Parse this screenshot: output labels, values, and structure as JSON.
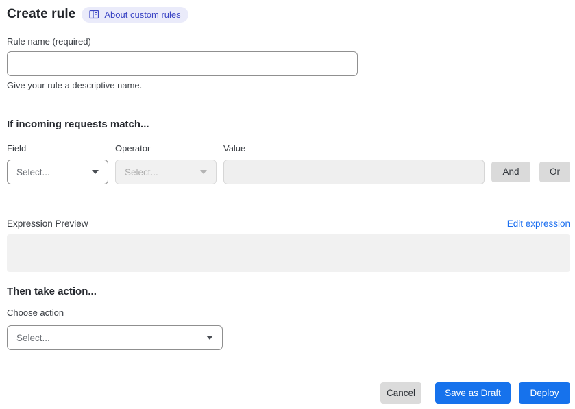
{
  "page": {
    "title": "Create rule",
    "badge": {
      "label": "About custom rules"
    }
  },
  "rule_name": {
    "label": "Rule name (required)",
    "value": "",
    "help": "Give your rule a descriptive name."
  },
  "match_section": {
    "heading": "If incoming requests match...",
    "field": {
      "label": "Field",
      "value": "Select..."
    },
    "operator": {
      "label": "Operator",
      "value": "Select..."
    },
    "value": {
      "label": "Value",
      "value": ""
    },
    "and_label": "And",
    "or_label": "Or",
    "expression_preview_label": "Expression Preview",
    "edit_expression_label": "Edit expression",
    "expression_value": ""
  },
  "action_section": {
    "heading": "Then take action...",
    "choose_action_label": "Choose action",
    "action_value": "Select..."
  },
  "footer": {
    "cancel_label": "Cancel",
    "save_draft_label": "Save as Draft",
    "deploy_label": "Deploy"
  },
  "colors": {
    "primary_blue": "#1672ec",
    "link_blue": "#1a6ef0",
    "badge_bg": "#eaebfa",
    "badge_text": "#3b45c4",
    "disabled_bg": "#f1f1f1",
    "preview_box_bg": "#f1f1f1",
    "neutral_button_bg": "#dadada"
  }
}
